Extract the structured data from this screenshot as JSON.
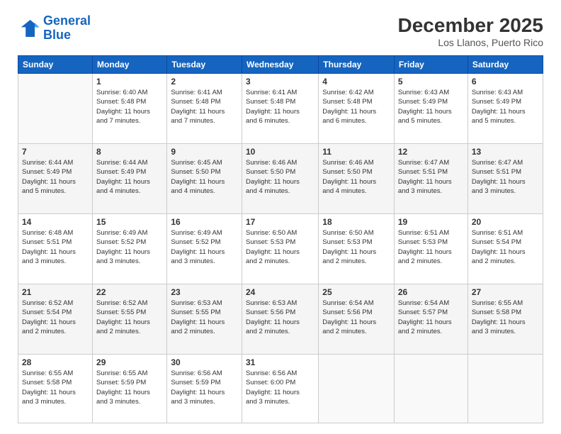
{
  "logo": {
    "line1": "General",
    "line2": "Blue"
  },
  "title": "December 2025",
  "location": "Los Llanos, Puerto Rico",
  "headers": [
    "Sunday",
    "Monday",
    "Tuesday",
    "Wednesday",
    "Thursday",
    "Friday",
    "Saturday"
  ],
  "weeks": [
    [
      {
        "day": "",
        "info": ""
      },
      {
        "day": "1",
        "info": "Sunrise: 6:40 AM\nSunset: 5:48 PM\nDaylight: 11 hours\nand 7 minutes."
      },
      {
        "day": "2",
        "info": "Sunrise: 6:41 AM\nSunset: 5:48 PM\nDaylight: 11 hours\nand 7 minutes."
      },
      {
        "day": "3",
        "info": "Sunrise: 6:41 AM\nSunset: 5:48 PM\nDaylight: 11 hours\nand 6 minutes."
      },
      {
        "day": "4",
        "info": "Sunrise: 6:42 AM\nSunset: 5:48 PM\nDaylight: 11 hours\nand 6 minutes."
      },
      {
        "day": "5",
        "info": "Sunrise: 6:43 AM\nSunset: 5:49 PM\nDaylight: 11 hours\nand 5 minutes."
      },
      {
        "day": "6",
        "info": "Sunrise: 6:43 AM\nSunset: 5:49 PM\nDaylight: 11 hours\nand 5 minutes."
      }
    ],
    [
      {
        "day": "7",
        "info": "Sunrise: 6:44 AM\nSunset: 5:49 PM\nDaylight: 11 hours\nand 5 minutes."
      },
      {
        "day": "8",
        "info": "Sunrise: 6:44 AM\nSunset: 5:49 PM\nDaylight: 11 hours\nand 4 minutes."
      },
      {
        "day": "9",
        "info": "Sunrise: 6:45 AM\nSunset: 5:50 PM\nDaylight: 11 hours\nand 4 minutes."
      },
      {
        "day": "10",
        "info": "Sunrise: 6:46 AM\nSunset: 5:50 PM\nDaylight: 11 hours\nand 4 minutes."
      },
      {
        "day": "11",
        "info": "Sunrise: 6:46 AM\nSunset: 5:50 PM\nDaylight: 11 hours\nand 4 minutes."
      },
      {
        "day": "12",
        "info": "Sunrise: 6:47 AM\nSunset: 5:51 PM\nDaylight: 11 hours\nand 3 minutes."
      },
      {
        "day": "13",
        "info": "Sunrise: 6:47 AM\nSunset: 5:51 PM\nDaylight: 11 hours\nand 3 minutes."
      }
    ],
    [
      {
        "day": "14",
        "info": "Sunrise: 6:48 AM\nSunset: 5:51 PM\nDaylight: 11 hours\nand 3 minutes."
      },
      {
        "day": "15",
        "info": "Sunrise: 6:49 AM\nSunset: 5:52 PM\nDaylight: 11 hours\nand 3 minutes."
      },
      {
        "day": "16",
        "info": "Sunrise: 6:49 AM\nSunset: 5:52 PM\nDaylight: 11 hours\nand 3 minutes."
      },
      {
        "day": "17",
        "info": "Sunrise: 6:50 AM\nSunset: 5:53 PM\nDaylight: 11 hours\nand 2 minutes."
      },
      {
        "day": "18",
        "info": "Sunrise: 6:50 AM\nSunset: 5:53 PM\nDaylight: 11 hours\nand 2 minutes."
      },
      {
        "day": "19",
        "info": "Sunrise: 6:51 AM\nSunset: 5:53 PM\nDaylight: 11 hours\nand 2 minutes."
      },
      {
        "day": "20",
        "info": "Sunrise: 6:51 AM\nSunset: 5:54 PM\nDaylight: 11 hours\nand 2 minutes."
      }
    ],
    [
      {
        "day": "21",
        "info": "Sunrise: 6:52 AM\nSunset: 5:54 PM\nDaylight: 11 hours\nand 2 minutes."
      },
      {
        "day": "22",
        "info": "Sunrise: 6:52 AM\nSunset: 5:55 PM\nDaylight: 11 hours\nand 2 minutes."
      },
      {
        "day": "23",
        "info": "Sunrise: 6:53 AM\nSunset: 5:55 PM\nDaylight: 11 hours\nand 2 minutes."
      },
      {
        "day": "24",
        "info": "Sunrise: 6:53 AM\nSunset: 5:56 PM\nDaylight: 11 hours\nand 2 minutes."
      },
      {
        "day": "25",
        "info": "Sunrise: 6:54 AM\nSunset: 5:56 PM\nDaylight: 11 hours\nand 2 minutes."
      },
      {
        "day": "26",
        "info": "Sunrise: 6:54 AM\nSunset: 5:57 PM\nDaylight: 11 hours\nand 2 minutes."
      },
      {
        "day": "27",
        "info": "Sunrise: 6:55 AM\nSunset: 5:58 PM\nDaylight: 11 hours\nand 3 minutes."
      }
    ],
    [
      {
        "day": "28",
        "info": "Sunrise: 6:55 AM\nSunset: 5:58 PM\nDaylight: 11 hours\nand 3 minutes."
      },
      {
        "day": "29",
        "info": "Sunrise: 6:55 AM\nSunset: 5:59 PM\nDaylight: 11 hours\nand 3 minutes."
      },
      {
        "day": "30",
        "info": "Sunrise: 6:56 AM\nSunset: 5:59 PM\nDaylight: 11 hours\nand 3 minutes."
      },
      {
        "day": "31",
        "info": "Sunrise: 6:56 AM\nSunset: 6:00 PM\nDaylight: 11 hours\nand 3 minutes."
      },
      {
        "day": "",
        "info": ""
      },
      {
        "day": "",
        "info": ""
      },
      {
        "day": "",
        "info": ""
      }
    ]
  ]
}
